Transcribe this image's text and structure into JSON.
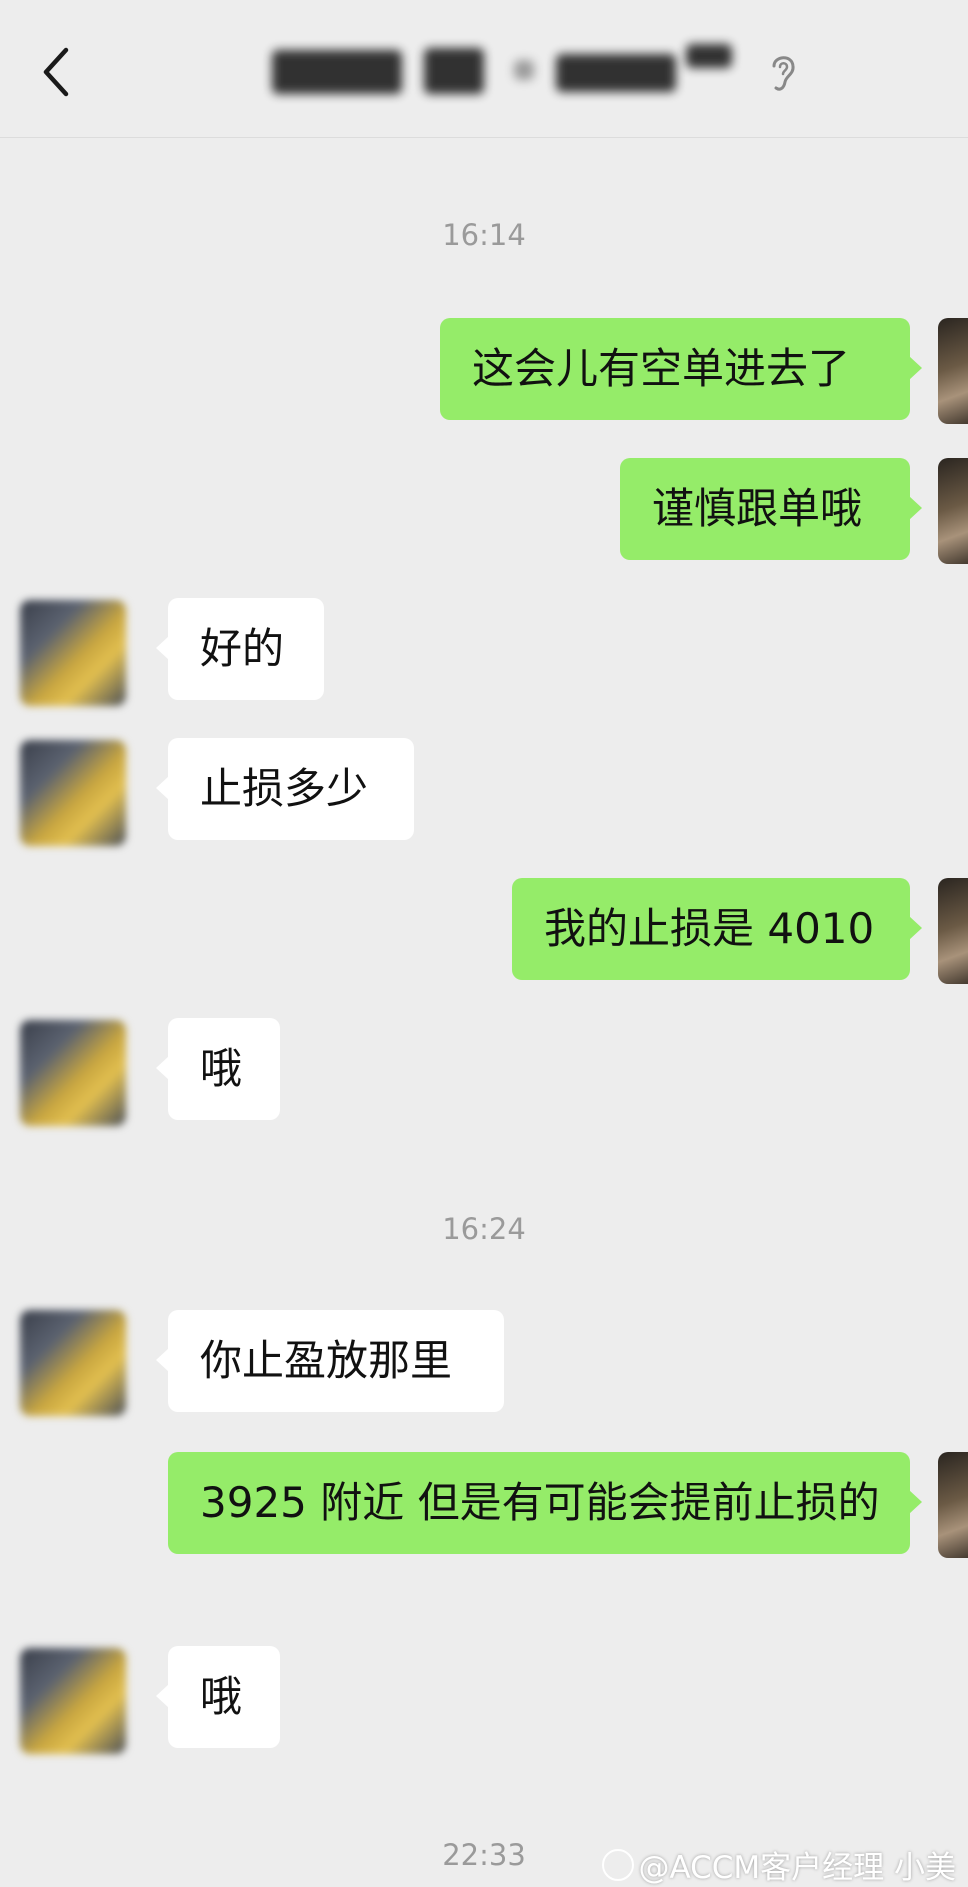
{
  "header": {
    "back_icon": "chevron-left-icon",
    "title_obscured": true,
    "ear_icon": "earpiece-mode-icon"
  },
  "messages": [
    {
      "type": "time",
      "text": "16:14"
    },
    {
      "type": "msg",
      "side": "right",
      "text": "这会儿有空单进去了"
    },
    {
      "type": "msg",
      "side": "right",
      "text": "谨慎跟单哦"
    },
    {
      "type": "msg",
      "side": "left",
      "text": "好的"
    },
    {
      "type": "msg",
      "side": "left",
      "text": "止损多少"
    },
    {
      "type": "msg",
      "side": "right",
      "text": "我的止损是 4010"
    },
    {
      "type": "msg",
      "side": "left",
      "text": "哦"
    },
    {
      "type": "time",
      "text": "16:24"
    },
    {
      "type": "msg",
      "side": "left",
      "text": "你止盈放那里"
    },
    {
      "type": "msg",
      "side": "right",
      "text": "3925 附近  但是有可能会提前止损的"
    },
    {
      "type": "msg",
      "side": "left",
      "text": "哦"
    },
    {
      "type": "time",
      "text": "22:33"
    }
  ],
  "watermark": "@ACCM客户经理 小美",
  "colors": {
    "background": "#ededed",
    "outgoing_bubble": "#95ec69",
    "incoming_bubble": "#ffffff",
    "timestamp_text": "#9a9a9a"
  }
}
